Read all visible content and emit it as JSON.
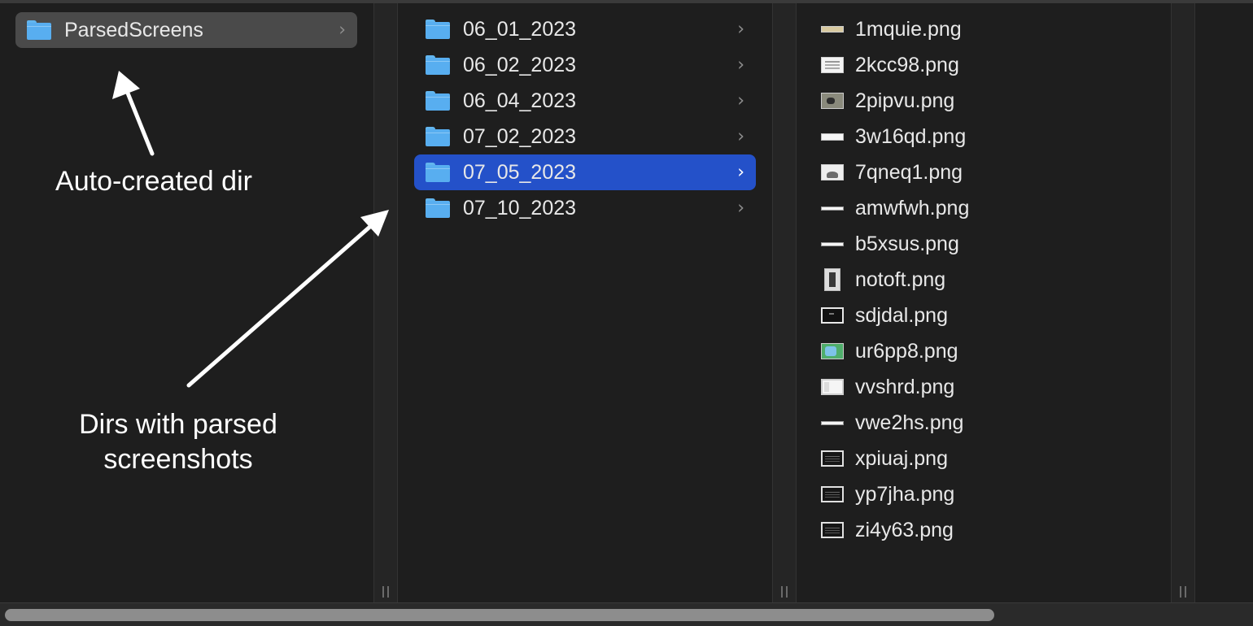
{
  "column1": {
    "items": [
      {
        "label": "ParsedScreens",
        "icon": "folder-icon",
        "selected": true
      }
    ]
  },
  "column2": {
    "items": [
      {
        "label": "06_01_2023",
        "icon": "folder-icon"
      },
      {
        "label": "06_02_2023",
        "icon": "folder-icon"
      },
      {
        "label": "06_04_2023",
        "icon": "folder-icon"
      },
      {
        "label": "07_02_2023",
        "icon": "folder-icon"
      },
      {
        "label": "07_05_2023",
        "icon": "folder-icon",
        "selected": true
      },
      {
        "label": "07_10_2023",
        "icon": "folder-icon"
      }
    ]
  },
  "column3": {
    "files": [
      {
        "label": "1mquie.png",
        "icon": "image-thumbnail-icon"
      },
      {
        "label": "2kcc98.png",
        "icon": "image-thumbnail-icon"
      },
      {
        "label": "2pipvu.png",
        "icon": "image-thumbnail-icon"
      },
      {
        "label": "3w16qd.png",
        "icon": "image-thumbnail-icon"
      },
      {
        "label": "7qneq1.png",
        "icon": "image-thumbnail-icon"
      },
      {
        "label": "amwfwh.png",
        "icon": "image-thumbnail-icon"
      },
      {
        "label": "b5xsus.png",
        "icon": "image-thumbnail-icon"
      },
      {
        "label": "notoft.png",
        "icon": "image-thumbnail-icon"
      },
      {
        "label": "sdjdal.png",
        "icon": "image-thumbnail-icon"
      },
      {
        "label": "ur6pp8.png",
        "icon": "image-thumbnail-icon"
      },
      {
        "label": "vvshrd.png",
        "icon": "image-thumbnail-icon"
      },
      {
        "label": "vwe2hs.png",
        "icon": "image-thumbnail-icon"
      },
      {
        "label": "xpiuaj.png",
        "icon": "image-thumbnail-icon"
      },
      {
        "label": "yp7jha.png",
        "icon": "image-thumbnail-icon"
      },
      {
        "label": "zi4y63.png",
        "icon": "image-thumbnail-icon"
      }
    ]
  },
  "annotations": {
    "auto_created": "Auto-created dir",
    "parsed_line1": "Dirs with parsed",
    "parsed_line2": "screenshots"
  },
  "chevron_glyph": "›",
  "colors": {
    "selection_blue": "#2451c9",
    "selection_grey": "#4a4a4a",
    "folder_blue": "#58aef0"
  }
}
